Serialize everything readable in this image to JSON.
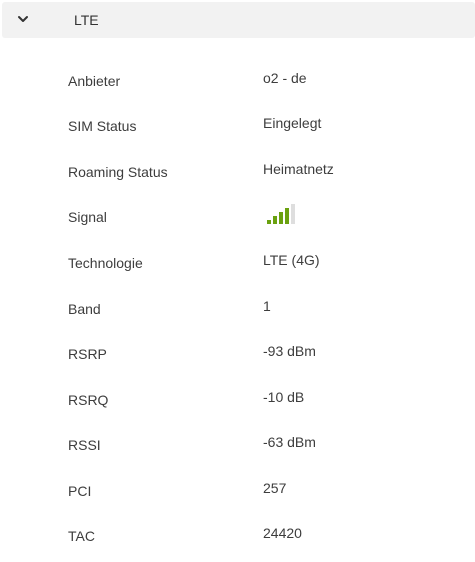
{
  "section": {
    "title": "LTE",
    "expanded": true,
    "icon": "chevron-down-icon"
  },
  "rows": [
    {
      "label": "Anbieter",
      "value": "o2 - de"
    },
    {
      "label": "SIM Status",
      "value": "Eingelegt"
    },
    {
      "label": "Roaming Status",
      "value": "Heimatnetz"
    },
    {
      "label": "Signal",
      "signal_level": 4,
      "signal_max": 5,
      "signal_icon": "signal-strength-icon"
    },
    {
      "label": "Technologie",
      "value": "LTE (4G)"
    },
    {
      "label": "Band",
      "value": "1"
    },
    {
      "label": "RSRP",
      "value": "-93 dBm"
    },
    {
      "label": "RSRQ",
      "value": "-10 dB"
    },
    {
      "label": "RSSI",
      "value": "-63 dBm"
    },
    {
      "label": "PCI",
      "value": "257"
    },
    {
      "label": "TAC",
      "value": "24420"
    }
  ],
  "colors": {
    "signal_active": "#6aa10f",
    "signal_inactive": "#dedede",
    "header_background": "#f2f2f2"
  }
}
